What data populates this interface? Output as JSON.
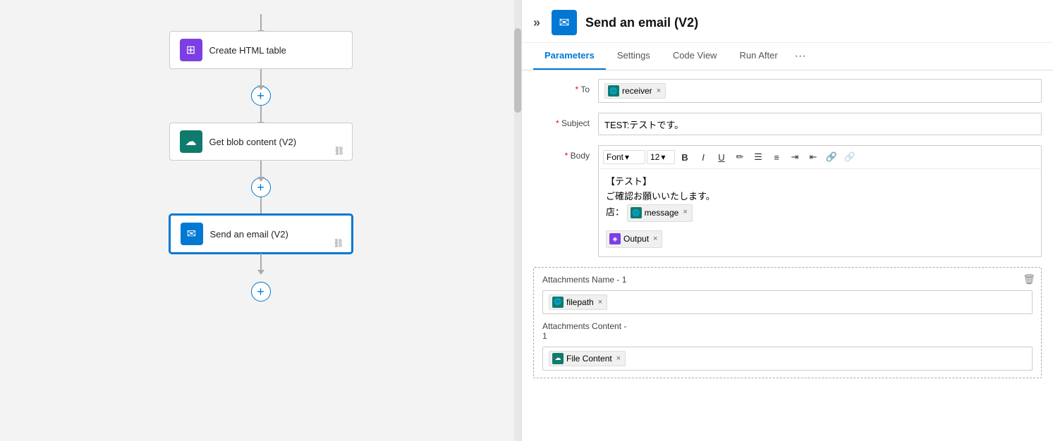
{
  "leftPanel": {
    "nodes": [
      {
        "id": "create-html-table",
        "label": "Create HTML table",
        "iconType": "purple",
        "iconSymbol": "⊞",
        "hasLink": false,
        "active": false
      },
      {
        "id": "get-blob-content",
        "label": "Get blob content (V2)",
        "iconType": "teal",
        "iconSymbol": "☁",
        "hasLink": true,
        "active": false
      },
      {
        "id": "send-email",
        "label": "Send an email (V2)",
        "iconType": "blue",
        "iconSymbol": "✉",
        "hasLink": true,
        "active": true
      }
    ],
    "addButtons": 3
  },
  "rightPanel": {
    "header": {
      "title": "Send an email (V2)",
      "collapseLabel": "«"
    },
    "tabs": [
      {
        "id": "parameters",
        "label": "Parameters",
        "active": true
      },
      {
        "id": "settings",
        "label": "Settings",
        "active": false
      },
      {
        "id": "code-view",
        "label": "Code View",
        "active": false
      },
      {
        "id": "run-after",
        "label": "Run After",
        "active": false
      }
    ],
    "fields": {
      "to": {
        "label": "* To",
        "token": {
          "text": "receiver",
          "iconType": "teal",
          "iconSymbol": "🌐"
        }
      },
      "subject": {
        "label": "* Subject",
        "value": "TEST:テストです。"
      },
      "body": {
        "label": "* Body",
        "toolbar": {
          "fontLabel": "Font",
          "fontSizeLabel": "12",
          "buttons": [
            "B",
            "I",
            "U",
            "✏",
            "≡",
            "≣",
            "≡L",
            "≡R",
            "🔗",
            "🔗X"
          ]
        },
        "content": {
          "line1": "【テスト】",
          "line2": "ご確認お願いいたします。",
          "line3prefix": "店：",
          "messageToken": {
            "text": "message",
            "iconType": "teal"
          },
          "outputToken": {
            "text": "Output",
            "iconType": "purple"
          }
        }
      }
    },
    "attachments": {
      "nameLabel": "Attachments Name - 1",
      "nameToken": {
        "text": "filepath",
        "iconType": "teal",
        "iconSymbol": "🌐"
      },
      "contentLabel": "Attachments Content -\n1",
      "contentToken": {
        "text": "File Content",
        "iconType": "blue-teal",
        "iconSymbol": "☁"
      }
    }
  }
}
